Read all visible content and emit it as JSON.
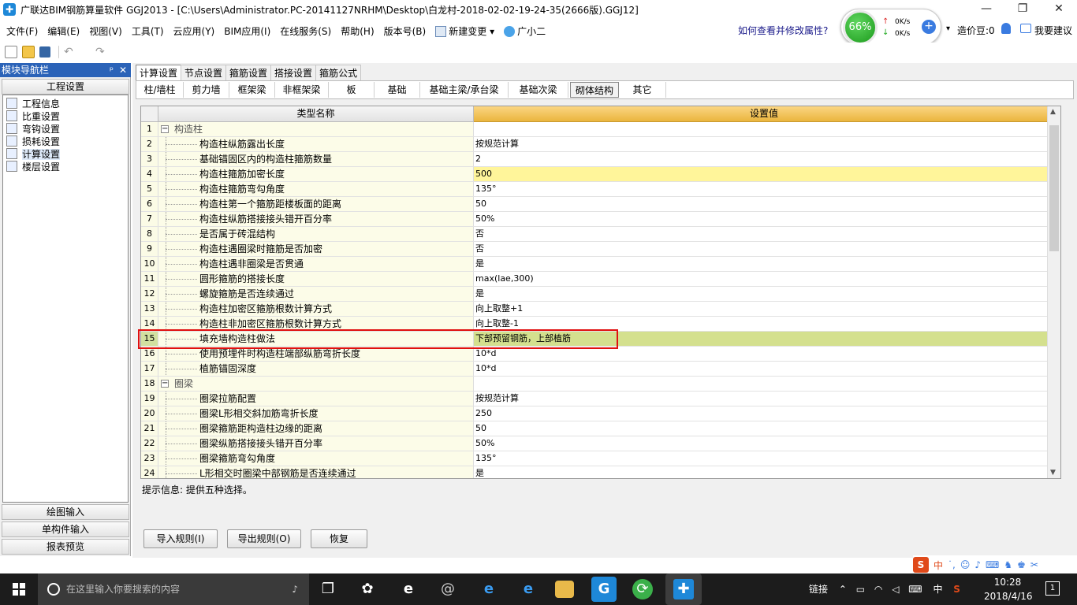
{
  "window": {
    "title": "广联达BIM钢筋算量软件 GGJ2013 - [C:\\Users\\Administrator.PC-20141127NRHM\\Desktop\\白龙村-2018-02-02-19-24-35(2666版).GGJ12]",
    "minimize_glyph": "—",
    "restore_glyph": "❐",
    "close_glyph": "✕"
  },
  "menubar": {
    "items": [
      "文件(F)",
      "编辑(E)",
      "视图(V)",
      "工具(T)",
      "云应用(Y)",
      "BIM应用(I)",
      "在线服务(S)",
      "帮助(H)",
      "版本号(B)",
      "新建变更",
      "广小二"
    ],
    "dropdown_glyph": "▾",
    "help_link": "如何查看并修改属性?",
    "cost_beans": "造价豆:0",
    "suggest": "我要建议"
  },
  "speed_widget": {
    "percent": "66%",
    "upload": "0K/s",
    "download": "0K/s",
    "up_glyph": "↑",
    "down_glyph": "↓",
    "plus_glyph": "+"
  },
  "nav": {
    "header": "模块导航栏",
    "pin_glyph": "ᵖ",
    "close_glyph": "✕",
    "section_top": "工程设置",
    "items": [
      "工程信息",
      "比重设置",
      "弯钩设置",
      "损耗设置",
      "计算设置",
      "楼层设置"
    ],
    "selected_index": 4,
    "bottom_sections": [
      "绘图输入",
      "单构件输入",
      "报表预览"
    ]
  },
  "tabs_primary": [
    "计算设置",
    "节点设置",
    "箍筋设置",
    "搭接设置",
    "箍筋公式"
  ],
  "tabs_secondary": [
    "柱/墙柱",
    "剪力墙",
    "框架梁",
    "非框架梁",
    "板",
    "基础",
    "基础主梁/承台梁",
    "基础次梁",
    "砌体结构",
    "其它"
  ],
  "active_secondary": "砌体结构",
  "grid": {
    "col_name": "类型名称",
    "col_value": "设置值",
    "expand_glyph": "−",
    "rows": [
      {
        "n": "1",
        "name": "构造柱",
        "value": "",
        "group": true
      },
      {
        "n": "2",
        "name": "构造柱纵筋露出长度",
        "value": "按规范计算"
      },
      {
        "n": "3",
        "name": "基础锚固区内的构造柱箍筋数量",
        "value": "2"
      },
      {
        "n": "4",
        "name": "构造柱箍筋加密长度",
        "value": "500",
        "highlight": true
      },
      {
        "n": "5",
        "name": "构造柱箍筋弯勾角度",
        "value": "135°"
      },
      {
        "n": "6",
        "name": "构造柱第一个箍筋距楼板面的距离",
        "value": "50"
      },
      {
        "n": "7",
        "name": "构造柱纵筋搭接接头错开百分率",
        "value": "50%"
      },
      {
        "n": "8",
        "name": "是否属于砖混结构",
        "value": "否"
      },
      {
        "n": "9",
        "name": "构造柱遇圈梁时箍筋是否加密",
        "value": "否"
      },
      {
        "n": "10",
        "name": "构造柱遇非圈梁是否贯通",
        "value": "是"
      },
      {
        "n": "11",
        "name": "圆形箍筋的搭接长度",
        "value": "max(lae,300)"
      },
      {
        "n": "12",
        "name": "螺旋箍筋是否连续通过",
        "value": "是"
      },
      {
        "n": "13",
        "name": "构造柱加密区箍筋根数计算方式",
        "value": "向上取整+1"
      },
      {
        "n": "14",
        "name": "构造柱非加密区箍筋根数计算方式",
        "value": "向上取整-1"
      },
      {
        "n": "15",
        "name": "填充墙构造柱做法",
        "value": "下部预留钢筋，上部植筋",
        "selected": true
      },
      {
        "n": "16",
        "name": "使用预埋件时构造柱端部纵筋弯折长度",
        "value": "10*d"
      },
      {
        "n": "17",
        "name": "植筋锚固深度",
        "value": "10*d"
      },
      {
        "n": "18",
        "name": "圈梁",
        "value": "",
        "group": true
      },
      {
        "n": "19",
        "name": "圈梁拉筋配置",
        "value": "按规范计算"
      },
      {
        "n": "20",
        "name": "圈梁L形相交斜加筋弯折长度",
        "value": "250"
      },
      {
        "n": "21",
        "name": "圈梁箍筋距构造柱边缘的距离",
        "value": "50"
      },
      {
        "n": "22",
        "name": "圈梁纵筋搭接接头错开百分率",
        "value": "50%"
      },
      {
        "n": "23",
        "name": "圈梁箍筋弯勾角度",
        "value": "135°"
      },
      {
        "n": "24",
        "name": "L形相交时圈梁中部钢筋是否连续通过",
        "value": "是"
      }
    ],
    "scroll_up_glyph": "▲",
    "scroll_down_glyph": "▼"
  },
  "hint": "提示信息: 提供五种选择。",
  "buttons": [
    "导入规则(I)",
    "导出规则(O)",
    "恢复"
  ],
  "ime": {
    "label": "中",
    "items": [
      "S",
      "中",
      "˙,",
      "☺",
      "♪",
      "⌨",
      "♞",
      "♚",
      "✂"
    ]
  },
  "taskbar": {
    "search_placeholder": "在这里输入你要搜索的内容",
    "tray_link": "链接",
    "lang": "中",
    "time": "10:28",
    "date": "2018/4/16",
    "notify": "1"
  }
}
